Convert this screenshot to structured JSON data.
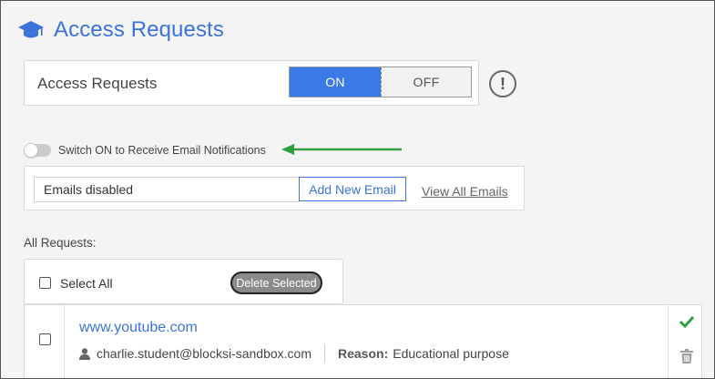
{
  "header": {
    "title": "Access Requests",
    "icon": "graduation-cap-icon"
  },
  "access_panel": {
    "label": "Access Requests",
    "on_label": "ON",
    "off_label": "OFF",
    "state": "ON",
    "info_glyph": "!"
  },
  "email_notifications": {
    "switch_label": "Switch ON to Receive Email Notifications",
    "enabled": false,
    "input_value": "Emails disabled",
    "add_button": "Add New Email",
    "view_all": "View All Emails"
  },
  "requests": {
    "section_label": "All Requests:",
    "select_all_label": "Select All",
    "delete_selected": "Delete Selected",
    "items": [
      {
        "url": "www.youtube.com",
        "user": "charlie.student@blocksi-sandbox.com",
        "reason_key": "Reason:",
        "reason": "Educational purpose"
      }
    ]
  },
  "colors": {
    "accent": "#3b73d9",
    "on_bg": "#3b7ae6",
    "arrow": "#2e9e3e",
    "approve": "#2e9e3e"
  }
}
